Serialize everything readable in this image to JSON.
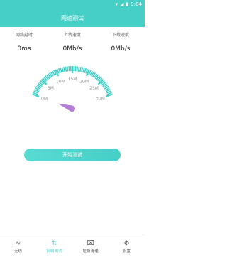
{
  "status_bar": {
    "time": "9:04",
    "wifi_icon": "wifi-icon",
    "signal_icon": "signal-icon",
    "battery_icon": "battery-icon"
  },
  "app_bar": {
    "title": "网速测试"
  },
  "metrics": [
    {
      "label": "网络延时",
      "value": "0ms"
    },
    {
      "label": "上传速度",
      "value": "0Mb/s"
    },
    {
      "label": "下载速度",
      "value": "0Mb/s"
    }
  ],
  "gauge": {
    "tick_labels": [
      "0M",
      "5M",
      "10M",
      "15M",
      "20M",
      "25M",
      "30M"
    ],
    "current_value": 0,
    "max": 30,
    "accent": "#45cfc6",
    "needle_color": "#b47fd8"
  },
  "start_button": {
    "label": "开始测试"
  },
  "bottom_nav": [
    {
      "label": "无线",
      "icon": "wifi-icon"
    },
    {
      "label": "网络测试",
      "icon": "network-test-icon"
    },
    {
      "label": "垃圾清理",
      "icon": "trash-icon"
    },
    {
      "label": "设置",
      "icon": "settings-icon"
    }
  ]
}
